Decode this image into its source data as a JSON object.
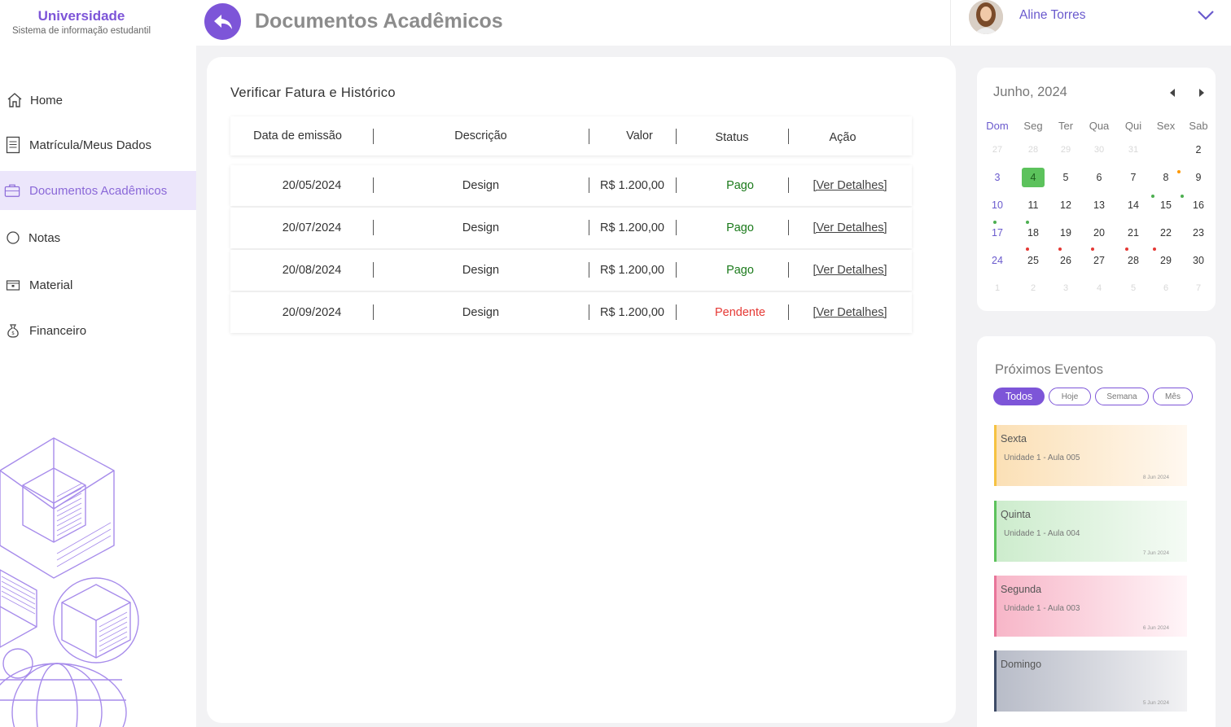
{
  "brand": {
    "title": "Universidade",
    "subtitle": "Sistema de informação estudantil"
  },
  "header": {
    "title": "Documentos Acadêmicos"
  },
  "user": {
    "name": "Aline Torres"
  },
  "sidebar": {
    "items": [
      {
        "label": "Home",
        "icon": "home-icon"
      },
      {
        "label": "Matrícula/Meus Dados",
        "icon": "document-icon"
      },
      {
        "label": "Documentos Acadêmicos",
        "icon": "briefcase-icon",
        "active": true
      },
      {
        "label": "Notas",
        "icon": "circle-icon"
      },
      {
        "label": "Material",
        "icon": "folder-icon"
      },
      {
        "label": "Financeiro",
        "icon": "money-bag-icon"
      }
    ]
  },
  "invoices": {
    "title": "Verificar Fatura e Histórico",
    "columns": [
      "Data de emissão",
      "Descrição",
      "Valor",
      "Status",
      "Ação"
    ],
    "rows": [
      {
        "date": "20/05/2024",
        "description": "Design",
        "value": "R$ 1.200,00",
        "status": "Pago",
        "action": "[Ver Detalhes]"
      },
      {
        "date": "20/07/2024",
        "description": "Design",
        "value": "R$ 1.200,00",
        "status": "Pago",
        "action": "[Ver Detalhes]"
      },
      {
        "date": "20/08/2024",
        "description": "Design",
        "value": "R$ 1.200,00",
        "status": "Pago",
        "action": "[Ver Detalhes]"
      },
      {
        "date": "20/09/2024",
        "description": "Design",
        "value": "R$ 1.200,00",
        "status": "Pendente",
        "action": "[Ver Detalhes]"
      }
    ]
  },
  "calendar": {
    "month": "Junho, 2024",
    "weekdays": [
      "Dom",
      "Seg",
      "Ter",
      "Qua",
      "Qui",
      "Sex",
      "Sab"
    ],
    "weeks": [
      [
        "27",
        "28",
        "29",
        "30",
        "31",
        "",
        "2"
      ],
      [
        "3",
        "4",
        "5",
        "6",
        "7",
        "8",
        "9"
      ],
      [
        "10",
        "11",
        "12",
        "13",
        "14",
        "15",
        "16"
      ],
      [
        "17",
        "18",
        "19",
        "20",
        "21",
        "22",
        "23"
      ],
      [
        "24",
        "25",
        "26",
        "27",
        "28",
        "29",
        "30"
      ],
      [
        "1",
        "2",
        "3",
        "4",
        "5",
        "6",
        "7"
      ]
    ],
    "today": "4",
    "colors": {
      "green": "#4caf50",
      "red": "#e53935",
      "orange": "#ff9800"
    }
  },
  "events": {
    "title": "Próximos Eventos",
    "filters": [
      "Todos",
      "Hoje",
      "Semana",
      "Mês"
    ],
    "active_filter": "Todos",
    "items": [
      {
        "day": "Sexta",
        "subtitle": "Unidade 1 - Aula 005",
        "date": "8 Jun 2024",
        "color": "#f5c242"
      },
      {
        "day": "Quinta",
        "subtitle": "Unidade 1 - Aula 004",
        "date": "7 Jun 2024",
        "color": "#5cc25c"
      },
      {
        "day": "Segunda",
        "subtitle": "Unidade 1 -  Aula 003",
        "date": "6 Jun 2024",
        "color": "#e8759a"
      },
      {
        "day": "Domingo",
        "subtitle": "",
        "date": "5 Jun 2024",
        "color": "#3d4a66"
      }
    ]
  }
}
